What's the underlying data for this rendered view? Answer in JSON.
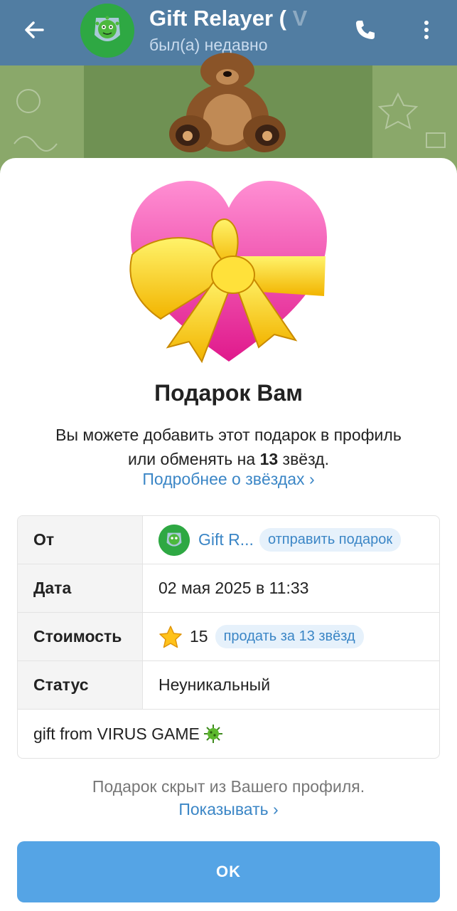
{
  "header": {
    "title": "Gift Relayer (",
    "title_fade": " V",
    "subtitle": "был(а) недавно",
    "back_icon": "arrow-back-icon",
    "call_icon": "phone-icon",
    "more_icon": "more-vertical-icon"
  },
  "gift": {
    "title": "Подарок Вам",
    "description_part1": "Вы можете добавить этот подарок в профиль или обменять на ",
    "description_stars": "13",
    "description_part2": " звёзд.",
    "more_link": "Подробнее о звёздах ›"
  },
  "details": {
    "from_label": "От",
    "from_name": "Gift R...",
    "send_gift": "отправить подарок",
    "date_label": "Дата",
    "date_value": "02 мая 2025 в 11:33",
    "cost_label": "Стоимость",
    "cost_value": "15",
    "sell_label": "продать за 13 звёзд",
    "status_label": "Статус",
    "status_value": "Неуникальный",
    "comment": "gift from VIRUS GAME"
  },
  "footer": {
    "hidden_note": "Подарок скрыт из Вашего профиля.",
    "show_link": "Показывать ›",
    "ok_label": "OK"
  },
  "colors": {
    "header": "#517da2",
    "link": "#3b86c6",
    "button": "#55a4e5"
  }
}
